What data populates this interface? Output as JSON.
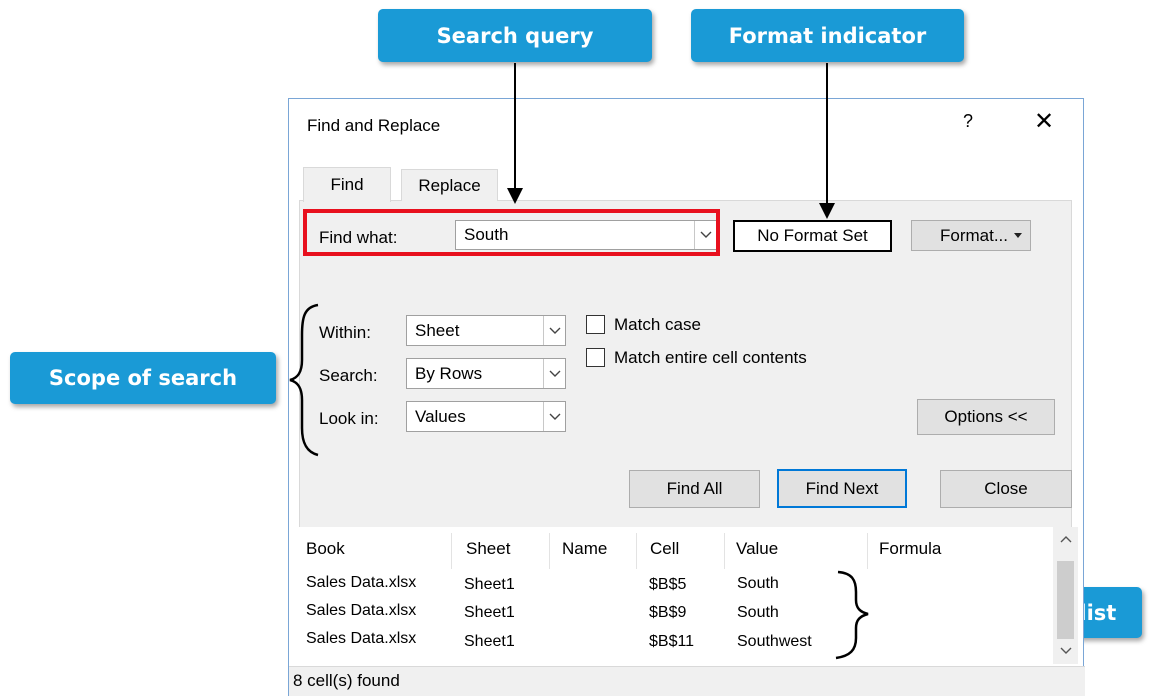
{
  "callouts": {
    "search_query": "Search query",
    "format_indicator": "Format indicator",
    "scope_of_search": "Scope of search",
    "search_results_list": "Search results list"
  },
  "dialog": {
    "title": "Find and Replace",
    "help": "?",
    "close": "✕",
    "tabs": [
      {
        "label": "Find",
        "selected": true
      },
      {
        "label": "Replace",
        "selected": false
      }
    ],
    "find_what_label": "Find what:",
    "find_what_value": "South",
    "format_indicator": "No Format Set",
    "format_button": "Format...",
    "within_label": "Within:",
    "within_value": "Sheet",
    "search_label": "Search:",
    "search_value": "By Rows",
    "look_in_label": "Look in:",
    "look_in_value": "Values",
    "match_case": {
      "label": "Match case",
      "checked": false
    },
    "match_entire": {
      "label": "Match entire cell contents",
      "checked": false
    },
    "options_button": "Options <<",
    "find_all_button": "Find All",
    "find_next_button": "Find Next",
    "close_button": "Close",
    "results": {
      "columns": [
        "Book",
        "Sheet",
        "Name",
        "Cell",
        "Value",
        "Formula"
      ],
      "rows": [
        {
          "book": "Sales Data.xlsx",
          "sheet": "Sheet1",
          "name": "",
          "cell": "$B$5",
          "value": "South",
          "formula": ""
        },
        {
          "book": "Sales Data.xlsx",
          "sheet": "Sheet1",
          "name": "",
          "cell": "$B$9",
          "value": "South",
          "formula": ""
        },
        {
          "book": "Sales Data.xlsx",
          "sheet": "Sheet1",
          "name": "",
          "cell": "$B$11",
          "value": "Southwest",
          "formula": ""
        }
      ]
    },
    "status": "8 cell(s) found"
  },
  "colors": {
    "callout": "#1a9ad6",
    "highlight": "#e8101e",
    "accent_border": "#0078d7"
  }
}
